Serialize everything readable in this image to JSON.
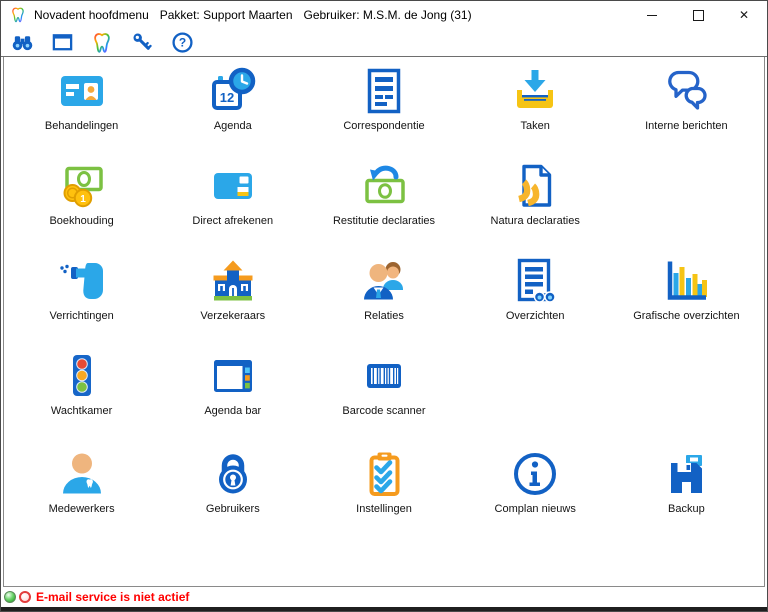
{
  "window": {
    "title": "Novadent hoofdmenu",
    "package_label": "Pakket: Support Maarten",
    "user_label": "Gebruiker: M.S.M. de Jong (31)",
    "controls": [
      {
        "name": "minimize"
      },
      {
        "name": "maximize"
      },
      {
        "name": "close"
      }
    ]
  },
  "toolbar": {
    "items": [
      {
        "name": "search",
        "icon": "binoculars-icon"
      },
      {
        "name": "window",
        "icon": "window-icon"
      },
      {
        "name": "novadent",
        "icon": "novadent-tooth-icon"
      },
      {
        "name": "access",
        "icon": "key-icon"
      },
      {
        "name": "help",
        "icon": "help-icon"
      }
    ]
  },
  "menu": {
    "items": [
      {
        "label": "Behandelingen",
        "icon": "patient-card-icon"
      },
      {
        "label": "Agenda",
        "icon": "calendar-clock-icon"
      },
      {
        "label": "Correspondentie",
        "icon": "letter-document-icon"
      },
      {
        "label": "Taken",
        "icon": "inbox-tray-icon"
      },
      {
        "label": "Interne berichten",
        "icon": "chat-bubbles-icon"
      },
      {
        "label": "Boekhouding",
        "icon": "money-coins-icon"
      },
      {
        "label": "Direct afrekenen",
        "icon": "bank-card-icon"
      },
      {
        "label": "Restitutie declaraties",
        "icon": "money-refund-icon"
      },
      {
        "label": "Natura declaraties",
        "icon": "vektis-document-icon"
      },
      {
        "label": "Verrichtingen",
        "icon": "dental-drill-icon"
      },
      {
        "label": "Verzekeraars",
        "icon": "office-building-icon"
      },
      {
        "label": "Relaties",
        "icon": "people-icon"
      },
      {
        "label": "Overzichten",
        "icon": "report-binoculars-icon"
      },
      {
        "label": "Grafische overzichten",
        "icon": "bar-chart-icon"
      },
      {
        "label": "Wachtkamer",
        "icon": "traffic-light-icon"
      },
      {
        "label": "Agenda bar",
        "icon": "window-sidebar-icon"
      },
      {
        "label": "Barcode scanner",
        "icon": "barcode-icon"
      },
      {
        "label": "Medewerkers",
        "icon": "dentist-person-icon"
      },
      {
        "label": "Gebruikers",
        "icon": "padlock-icon"
      },
      {
        "label": "Instellingen",
        "icon": "checklist-clipboard-icon"
      },
      {
        "label": "Complan nieuws",
        "icon": "info-icon"
      },
      {
        "label": "Backup",
        "icon": "floppy-disk-icon"
      }
    ]
  },
  "icon_glyphs": {
    "calendar_day": "12",
    "coin_value": "1",
    "help_glyph": "?"
  },
  "statusbar": {
    "indicators": [
      {
        "name": "service-indicator-green",
        "color": "#2eb52e"
      },
      {
        "name": "service-indicator-red",
        "color": "#e23c3c"
      }
    ],
    "message": "E-mail service is niet actief",
    "message_color": "#ff0000"
  },
  "colors": {
    "accent_blue": "#1261C4",
    "light_blue": "#2BA7E8",
    "yellow": "#F6C414",
    "orange": "#F59B1E",
    "green": "#7CC142",
    "red": "#E94B35"
  }
}
